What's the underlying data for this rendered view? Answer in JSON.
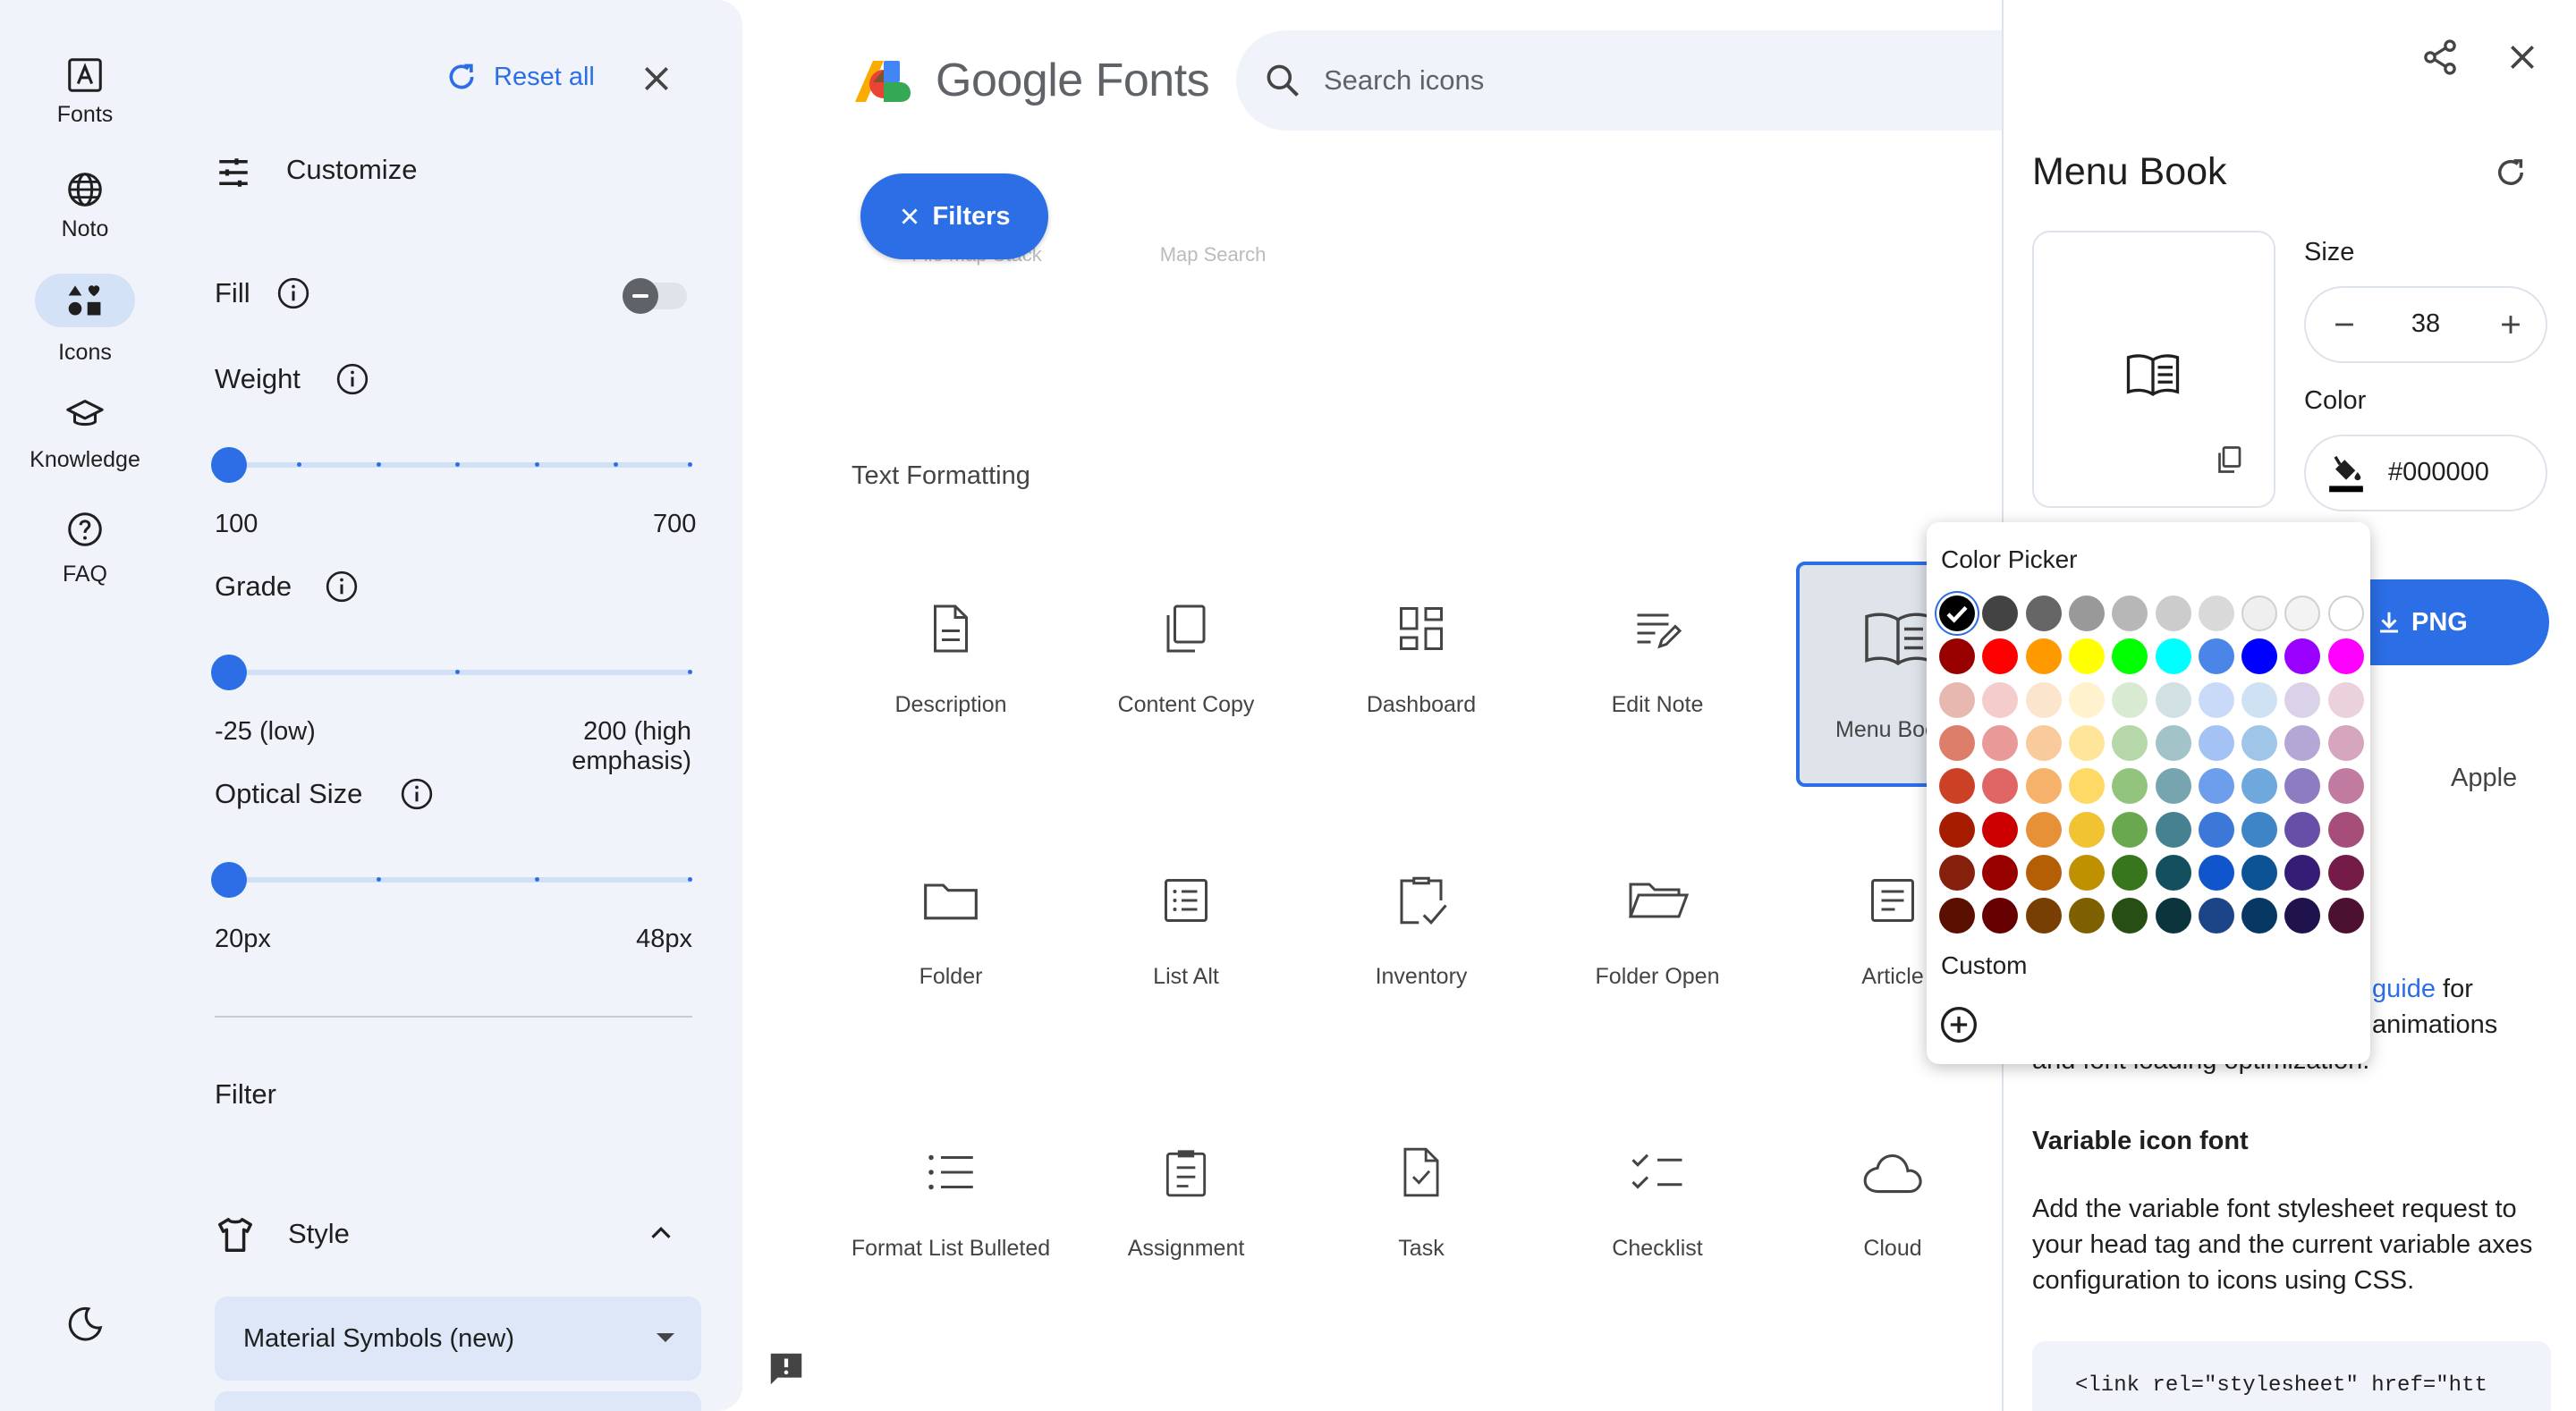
{
  "rail": {
    "items": [
      {
        "label": "Fonts",
        "icon": "font-a-icon"
      },
      {
        "label": "Noto",
        "icon": "globe-icon"
      },
      {
        "label": "Icons",
        "icon": "shapes-icon",
        "active": true
      },
      {
        "label": "Knowledge",
        "icon": "graduation-cap-icon"
      },
      {
        "label": "FAQ",
        "icon": "help-circle-icon"
      }
    ],
    "theme_icon": "moon-icon"
  },
  "customize": {
    "reset_label": "Reset all",
    "title": "Customize",
    "fill_label": "Fill",
    "weight_label": "Weight",
    "weight_min": "100",
    "weight_max": "700",
    "weight_value": 100,
    "grade_label": "Grade",
    "grade_min": "-25 (low)",
    "grade_max": "200 (high emphasis)",
    "grade_value": -25,
    "optical_label": "Optical Size",
    "optical_min": "20px",
    "optical_max": "48px",
    "optical_value": 20,
    "filter_label": "Filter",
    "style_label": "Style",
    "style_select": "Material Symbols (new)"
  },
  "header": {
    "brand": "Google Fonts",
    "search_placeholder": "Search icons"
  },
  "filters_button": "Filters",
  "faded_row": [
    "File Map Stack",
    "Map Search"
  ],
  "section_title": "Text Formatting",
  "icons": [
    {
      "label": "Description",
      "icon": "description-icon"
    },
    {
      "label": "Content Copy",
      "icon": "content-copy-icon"
    },
    {
      "label": "Dashboard",
      "icon": "dashboard-icon"
    },
    {
      "label": "Edit Note",
      "icon": "edit-note-icon"
    },
    {
      "label": "Menu Book",
      "icon": "menu-book-icon",
      "selected": true
    },
    {
      "label": "Folder",
      "icon": "folder-icon"
    },
    {
      "label": "List Alt",
      "icon": "list-alt-icon"
    },
    {
      "label": "Inventory",
      "icon": "inventory-icon"
    },
    {
      "label": "Folder Open",
      "icon": "folder-open-icon"
    },
    {
      "label": "Article",
      "icon": "article-icon"
    },
    {
      "label": "Format List Bulleted",
      "icon": "format-list-bulleted-icon"
    },
    {
      "label": "Assignment",
      "icon": "assignment-icon"
    },
    {
      "label": "Task",
      "icon": "task-icon"
    },
    {
      "label": "Checklist",
      "icon": "checklist-icon"
    },
    {
      "label": "Cloud",
      "icon": "cloud-icon"
    }
  ],
  "detail": {
    "title": "Menu Book",
    "size_label": "Size",
    "size_value": "38",
    "color_label": "Color",
    "color_value": "#000000",
    "png_label": "PNG",
    "platform_tab": "Apple",
    "guide_fragment": "guide",
    "guide_after": " for",
    "line_animations": "animations",
    "line_loading": "and font loading optimization.",
    "variable_title": "Variable icon font",
    "variable_desc_1": "Add the variable font stylesheet request to",
    "variable_desc_2": "your head tag and the current variable axes",
    "variable_desc_3": "configuration to icons using CSS.",
    "code_line": "<link rel=\"stylesheet\" href=\"htt"
  },
  "picker": {
    "title": "Color Picker",
    "custom_label": "Custom",
    "swatches": [
      [
        "#000000",
        "#434343",
        "#666666",
        "#999999",
        "#b7b7b7",
        "#cccccc",
        "#d9d9d9",
        "#efefef",
        "#f3f3f3",
        "#ffffff"
      ],
      [
        "#980000",
        "#ff0000",
        "#ff9900",
        "#ffff00",
        "#00ff00",
        "#00ffff",
        "#4a86e8",
        "#0000ff",
        "#9900ff",
        "#ff00ff"
      ],
      [
        "#e6b8af",
        "#f4cccc",
        "#fce5cd",
        "#fff2cc",
        "#d9ead3",
        "#d0e0e3",
        "#c9daf8",
        "#cfe2f3",
        "#d9d2e9",
        "#ead1dc"
      ],
      [
        "#dd7e6b",
        "#ea9999",
        "#f9cb9c",
        "#ffe599",
        "#b6d7a8",
        "#a2c4c9",
        "#a4c2f4",
        "#9fc5e8",
        "#b4a7d6",
        "#d5a6bd"
      ],
      [
        "#cc4125",
        "#e06666",
        "#f6b26b",
        "#ffd966",
        "#93c47d",
        "#76a5af",
        "#6d9eeb",
        "#6fa8dc",
        "#8e7cc3",
        "#c27ba0"
      ],
      [
        "#a61c00",
        "#cc0000",
        "#e69138",
        "#f1c232",
        "#6aa84f",
        "#45818e",
        "#3c78d8",
        "#3d85c6",
        "#674ea7",
        "#a64d79"
      ],
      [
        "#85200c",
        "#990000",
        "#b45f06",
        "#bf9000",
        "#38761d",
        "#134f5c",
        "#1155cc",
        "#0b5394",
        "#351c75",
        "#741b47"
      ],
      [
        "#5b0f00",
        "#660000",
        "#783f04",
        "#7f6000",
        "#274e13",
        "#0c343d",
        "#1c4587",
        "#073763",
        "#20124d",
        "#4c1130"
      ]
    ]
  }
}
